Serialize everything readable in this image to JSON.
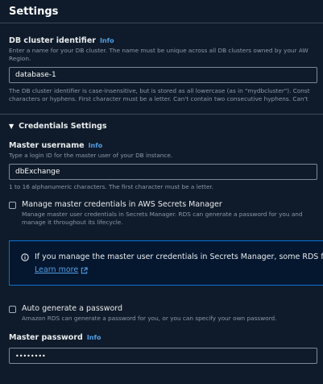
{
  "header": {
    "title": "Settings"
  },
  "cluster_identifier": {
    "label": "DB cluster identifier",
    "info": "Info",
    "description_line1": "Enter a name for your DB cluster. The name must be unique across all DB clusters owned by your AW",
    "description_line2": "Region.",
    "value": "database-1",
    "constraint_line1": "The DB cluster identifier is case-insensitive, but is stored as all lowercase (as in \"mydbcluster\"). Const",
    "constraint_line2": "characters or hyphens. First character must be a letter. Can't contain two consecutive hyphens. Can't"
  },
  "credentials": {
    "section_title": "Credentials Settings",
    "master_username": {
      "label": "Master username",
      "info": "Info",
      "description": "Type a login ID for the master user of your DB instance.",
      "value": "dbExchange",
      "constraint": "1 to 16 alphanumeric characters. The first character must be a letter."
    },
    "manage_secrets": {
      "label": "Manage master credentials in AWS Secrets Manager",
      "description_line1": "Manage master user credentials in Secrets Manager. RDS can generate a password for you and",
      "description_line2": "manage it throughout its lifecycle."
    },
    "alert": {
      "text": "If you manage the master user credentials in Secrets Manager, some RDS featu",
      "link": "Learn more"
    },
    "auto_generate": {
      "label": "Auto generate a password",
      "description": "Amazon RDS can generate a password for you, or you can specify your own password."
    },
    "master_password": {
      "label": "Master password",
      "info": "Info",
      "value": "••••••••"
    }
  },
  "colors": {
    "background": "#0f1b2a",
    "link": "#539fe5",
    "alert_border": "#0972d3"
  }
}
